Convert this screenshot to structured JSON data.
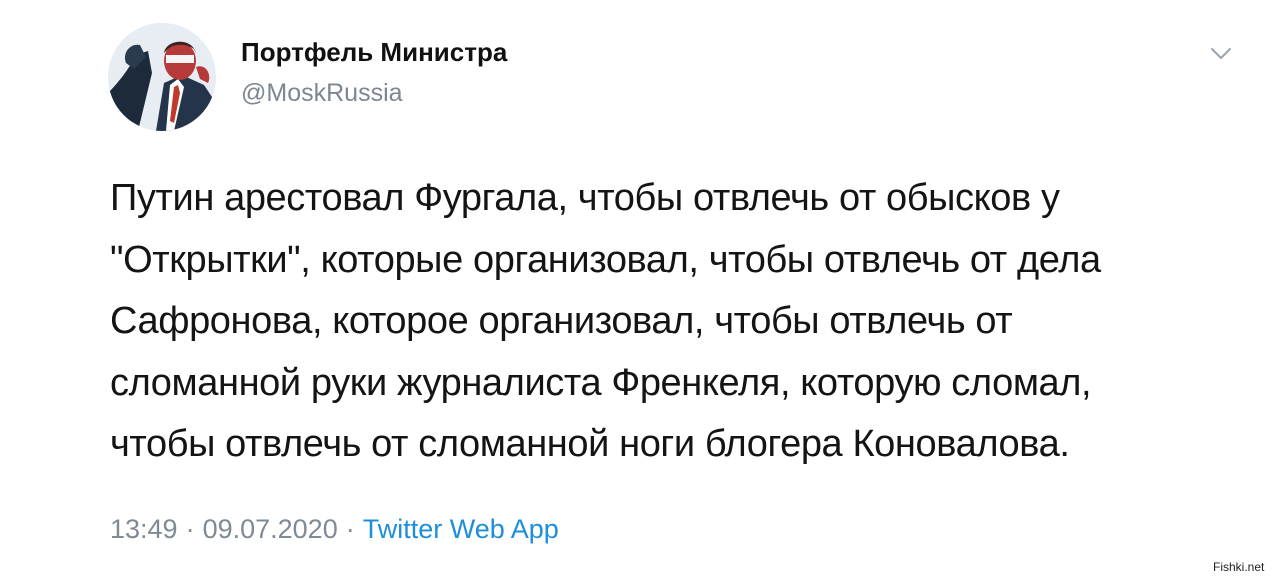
{
  "tweet": {
    "author": {
      "display_name": "Портфель Министра",
      "handle": "@MoskRussia",
      "avatar_icon": "user-avatar-icon"
    },
    "menu_icon": "chevron-down-icon",
    "text_lines": [
      "Путин арестовал Фургала, чтобы отвлечь от обысков у",
      "\"Открытки\", которые организовал, чтобы отвлечь от дела",
      "Сафронова, которое организовал, чтобы отвлечь от",
      "сломанной руки журналиста Френкеля, которую сломал,",
      "чтобы отвлечь от сломанной ноги блогера Коновалова."
    ],
    "meta": {
      "time": "13:49",
      "separator": "·",
      "date": "09.07.2020",
      "source": "Twitter Web App"
    }
  },
  "watermark": "Fishki.net",
  "colors": {
    "text": "#141414",
    "muted": "#7f8a95",
    "link": "#1d8fd9"
  }
}
